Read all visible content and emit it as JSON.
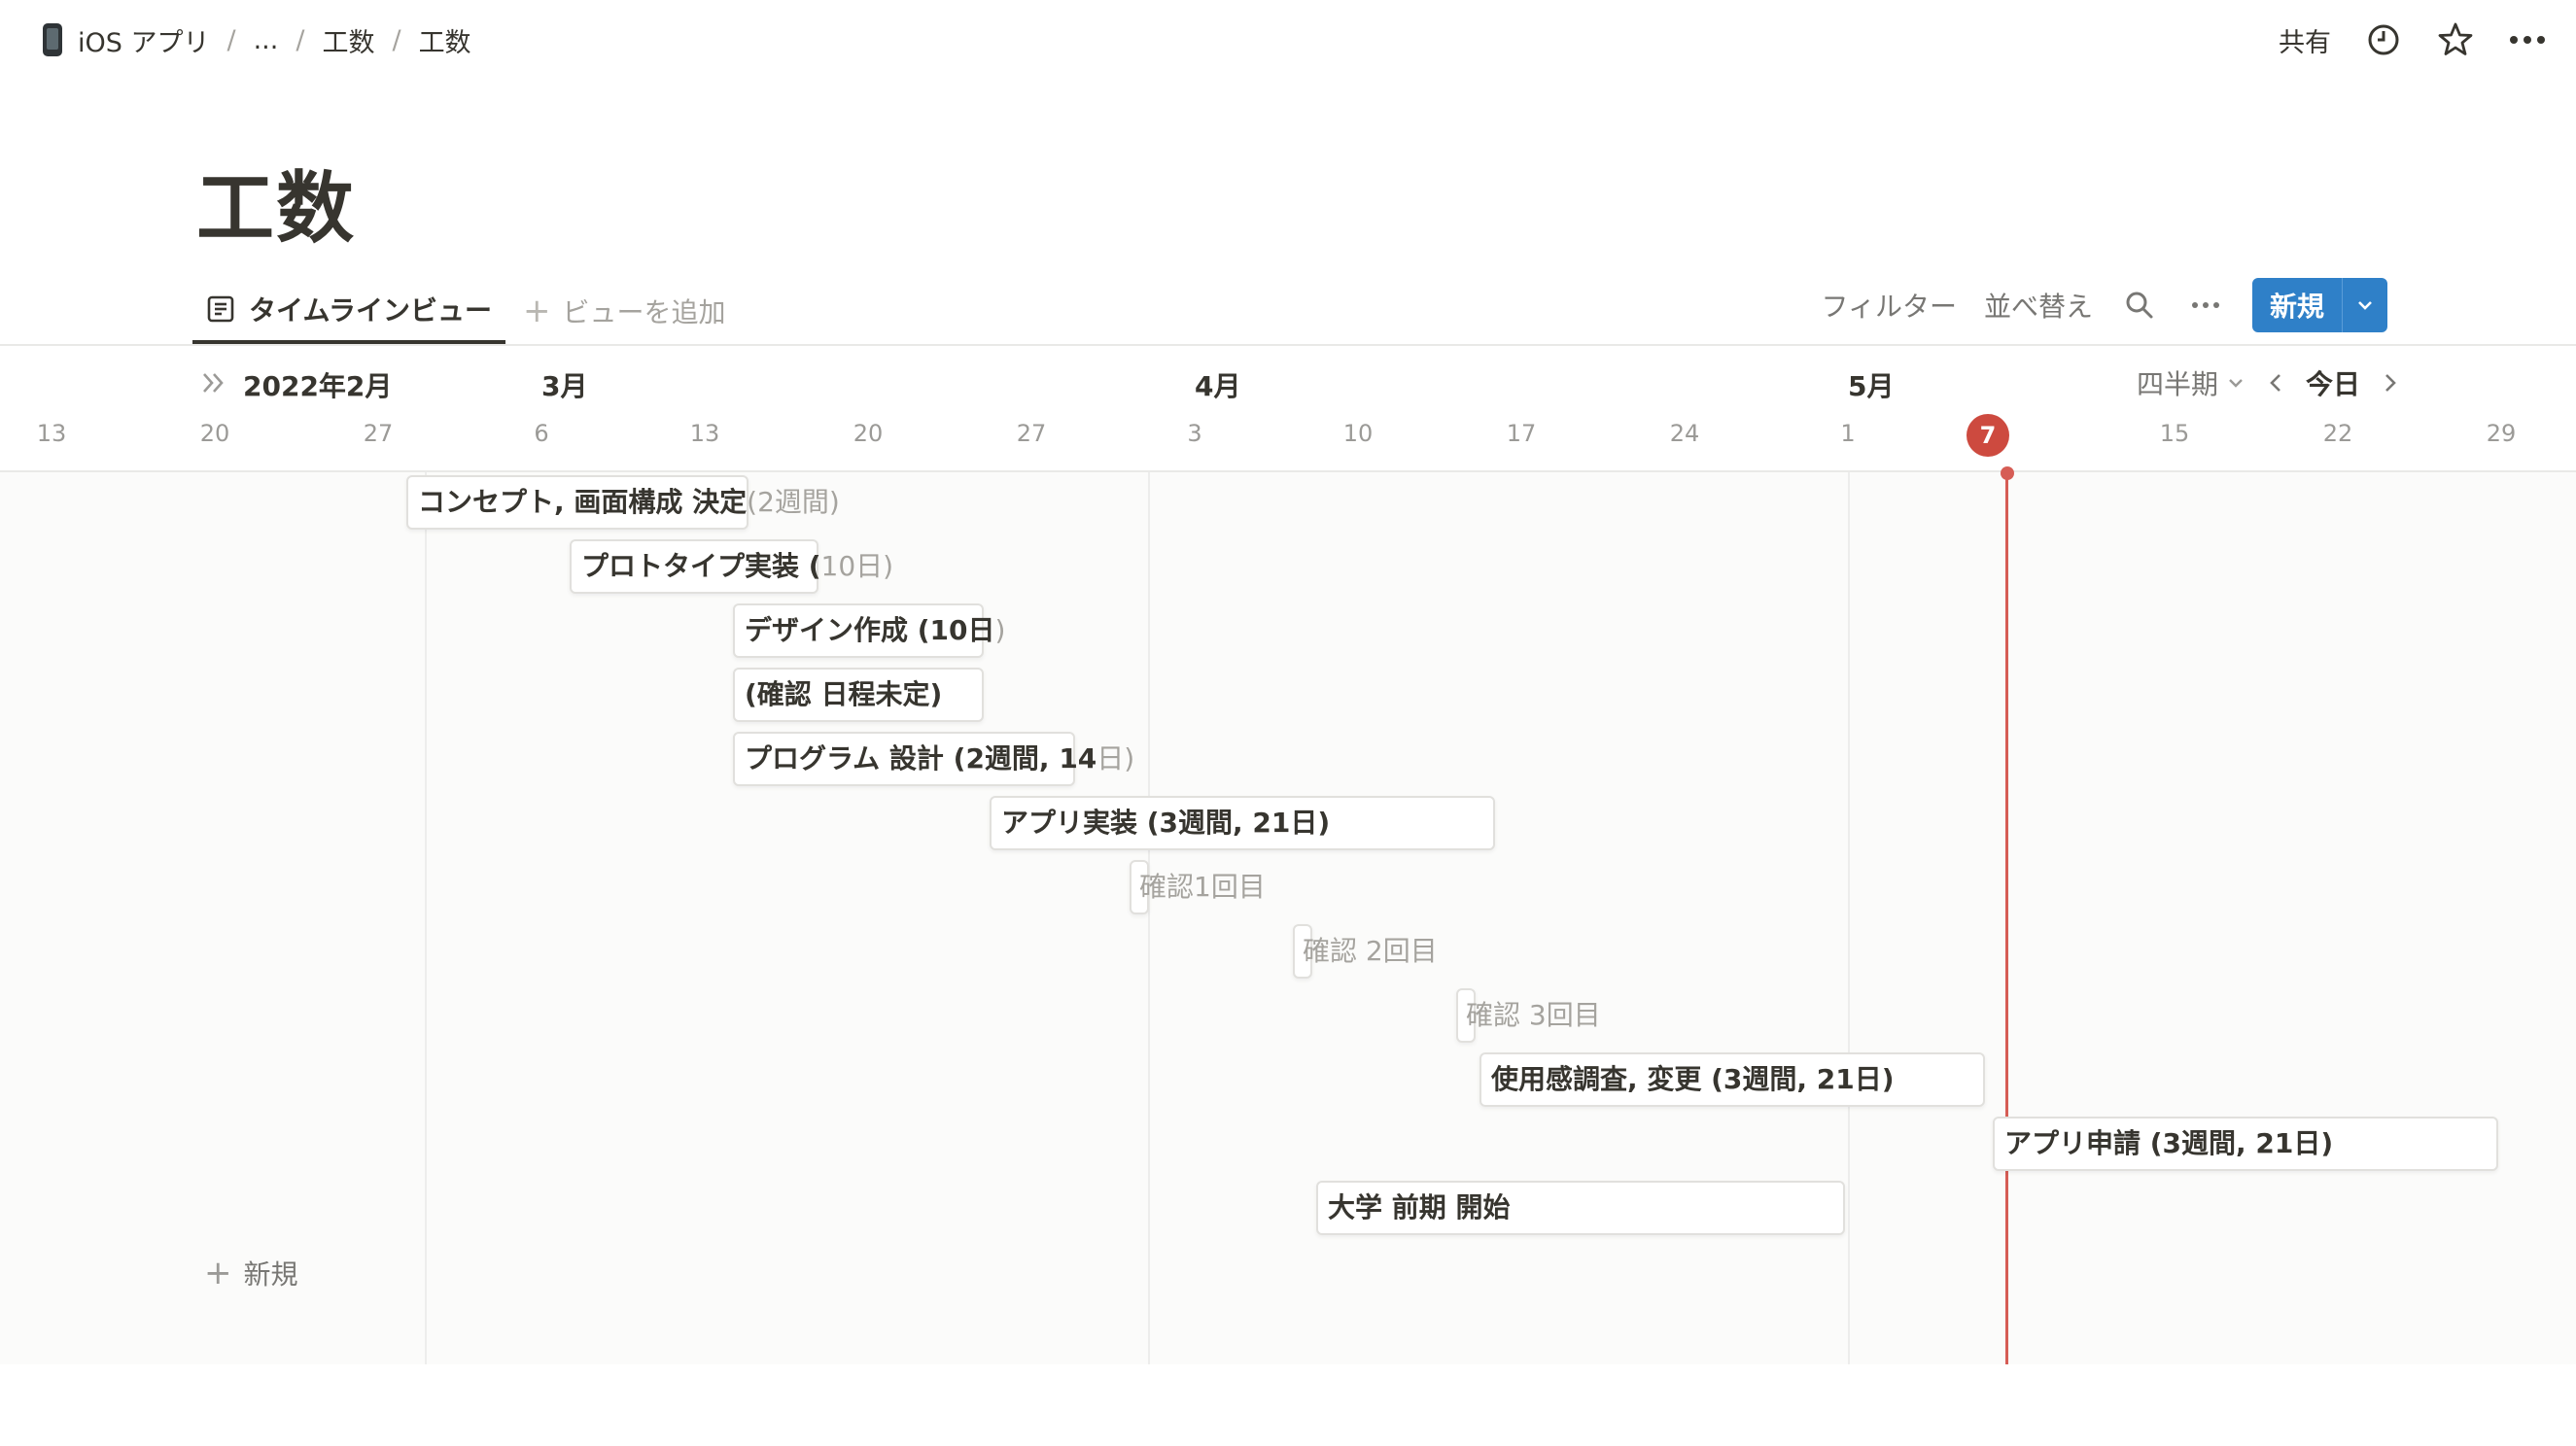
{
  "breadcrumbs": [
    "iOS アプリ",
    "...",
    "工数",
    "工数"
  ],
  "header_actions": {
    "share": "共有"
  },
  "page": {
    "title": "工数"
  },
  "view": {
    "active_tab": "タイムラインビュー",
    "add_view": "ビューを追加"
  },
  "toolbar": {
    "filter": "フィルター",
    "sort": "並べ替え",
    "new": "新規"
  },
  "timeline": {
    "months": [
      "2022年2月",
      "3月",
      "4月",
      "5月"
    ],
    "days": [
      "13",
      "20",
      "27",
      "6",
      "13",
      "20",
      "27",
      "3",
      "10",
      "17",
      "24",
      "1",
      "7",
      "15",
      "22",
      "29"
    ],
    "today_day": "7",
    "scale": "四半期",
    "today_label": "今日"
  },
  "items": [
    {
      "title": "コンセプト, 画面構成 決定",
      "suffix": "(2週間)"
    },
    {
      "title": "プロトタイプ実装 (",
      "suffix": "10日)"
    },
    {
      "title": "デザイン作成 (10日",
      "suffix": ")"
    },
    {
      "title": "(確認 日程未定)",
      "suffix": ""
    },
    {
      "title": "プログラム 設計 (2週間, 14",
      "suffix": "日)"
    },
    {
      "title": "アプリ実装 (3週間, 21日)",
      "suffix": ""
    },
    {
      "title": "確認1回目",
      "suffix": ""
    },
    {
      "title": "確認 2回目",
      "suffix": ""
    },
    {
      "title": "確認 3回目",
      "suffix": ""
    },
    {
      "title": "使用感調査, 変更 (3週間, 21日)",
      "suffix": ""
    },
    {
      "title": "アプリ申請 (3週間, 21日)",
      "suffix": ""
    },
    {
      "title": "大学 前期 開始",
      "suffix": ""
    }
  ],
  "add_row": "新規",
  "icons": {
    "breadcrumb": "phone-icon",
    "history": "clock-icon",
    "favorite": "star-icon",
    "more": "more-icon",
    "view": "timeline-view-icon",
    "search": "search-icon"
  },
  "colors": {
    "accent": "#2f80c8",
    "today": "#cd4a3f"
  }
}
